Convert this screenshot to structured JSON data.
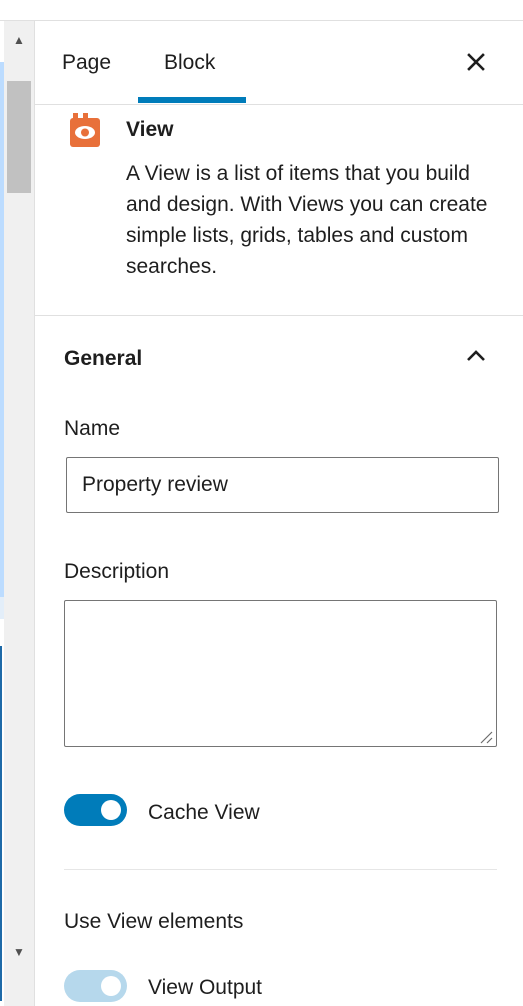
{
  "tabs": [
    {
      "label": "Page",
      "active": false
    },
    {
      "label": "Block",
      "active": true
    }
  ],
  "block": {
    "icon": "eye-icon",
    "title": "View",
    "description": "A View is a list of items that you build and design. With Views you can create simple lists, grids, tables and custom searches."
  },
  "general": {
    "title": "General",
    "name_label": "Name",
    "name_value": "Property review",
    "description_label": "Description",
    "description_value": "",
    "cache_label": "Cache View",
    "cache_enabled": true,
    "use_elements_label": "Use View elements",
    "view_output_label": "View Output",
    "view_output_enabled": true
  },
  "colors": {
    "accent": "#007cba",
    "accent_muted": "#b6d8ec",
    "icon_orange": "#e8703a"
  }
}
